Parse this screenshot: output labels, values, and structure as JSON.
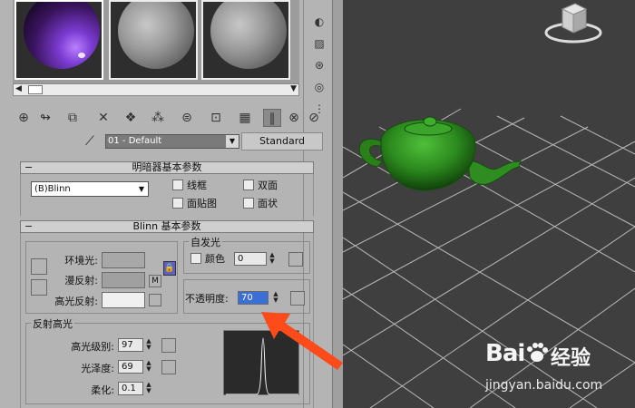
{
  "material_editor": {
    "material_name": "01 - Default",
    "material_type_button": "Standard",
    "eyedropper_icon": "eyedropper-icon",
    "shader_rollout": {
      "title": "明暗器基本参数",
      "shader": "(B)Blinn",
      "options": [
        {
          "label": "线框",
          "checked": false
        },
        {
          "label": "双面",
          "checked": false
        },
        {
          "label": "面贴图",
          "checked": false
        },
        {
          "label": "面状",
          "checked": false
        }
      ]
    },
    "blinn_rollout": {
      "title": "Blinn 基本参数",
      "ambient_label": "环境光:",
      "diffuse_label": "漫反射:",
      "diffuse_map_button": "M",
      "specular_label": "高光反射:",
      "self_illum": {
        "title": "自发光",
        "color_label": "颜色",
        "value": "0"
      },
      "opacity_label": "不透明度:",
      "opacity_value": "70",
      "specular_highlights": {
        "title": "反射高光",
        "level_label": "高光级别:",
        "level_value": "97",
        "gloss_label": "光泽度:",
        "gloss_value": "69",
        "soften_label": "柔化:",
        "soften_value": "0.1"
      }
    },
    "colors": {
      "ambient": "#a8a8a8",
      "diffuse": "#a0a0a0",
      "specular": "#f0f0f0",
      "opacity_highlight": "#3a6fd6",
      "annotation_arrow": "#ff4a1a"
    }
  },
  "viewport": {
    "object": "teapot",
    "object_color": "#2c8a1e",
    "background": "#3f3f3f"
  },
  "watermark": {
    "brand": "Bai",
    "brand_tail": "经验",
    "url": "jingyan.baidu.com"
  }
}
